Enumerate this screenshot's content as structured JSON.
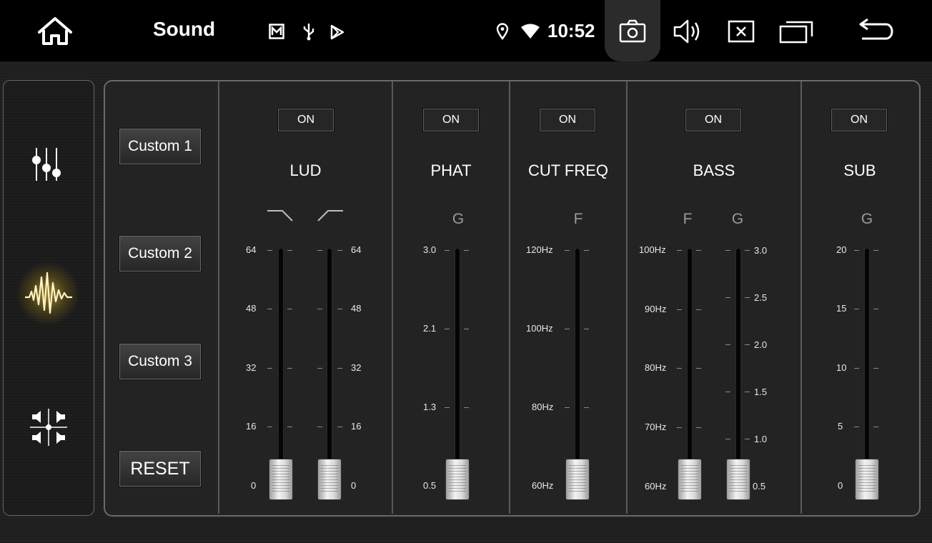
{
  "statusbar": {
    "title": "Sound",
    "clock": "10:52",
    "icons": [
      "home-icon",
      "gallery-notification-icon",
      "usb-icon",
      "play-store-icon",
      "location-icon",
      "wifi-icon",
      "screenshot-icon",
      "volume-icon",
      "close-app-icon",
      "recent-apps-icon",
      "back-icon"
    ]
  },
  "sidebar": {
    "items": [
      {
        "name": "equalizer-sliders-icon",
        "active": false
      },
      {
        "name": "sound-wave-icon",
        "active": true
      },
      {
        "name": "speaker-balance-icon",
        "active": false
      }
    ],
    "accent_color": "#ffd23c"
  },
  "presets": {
    "custom1": "Custom 1",
    "custom2": "Custom 2",
    "custom3": "Custom 3",
    "reset": "RESET"
  },
  "columns": {
    "lud": {
      "toggle": "ON",
      "title": "LUD",
      "sliders": [
        {
          "icon": "high-cut-filter-icon",
          "labels": [
            "64",
            "48",
            "32",
            "16",
            "0"
          ],
          "value": "0"
        },
        {
          "icon": "low-cut-filter-icon",
          "labels": [
            "64",
            "48",
            "32",
            "16",
            "0"
          ],
          "value": "0"
        }
      ]
    },
    "phat": {
      "toggle": "ON",
      "title": "PHAT",
      "sub": "G",
      "labels": [
        "3.0",
        "2.1",
        "1.3",
        "0.5"
      ],
      "value": "0.5"
    },
    "cut_freq": {
      "toggle": "ON",
      "title": "CUT FREQ",
      "sub": "F",
      "labels": [
        "120Hz",
        "100Hz",
        "80Hz",
        "60Hz"
      ],
      "value": "60Hz"
    },
    "bass": {
      "toggle": "ON",
      "title": "BASS",
      "sub_f": "F",
      "sub_g": "G",
      "f_labels": [
        "100Hz",
        "90Hz",
        "80Hz",
        "70Hz",
        "60Hz"
      ],
      "g_labels": [
        "3.0",
        "2.5",
        "2.0",
        "1.5",
        "1.0",
        "0.5"
      ],
      "f_value": "60Hz",
      "g_value": "0.5"
    },
    "sub": {
      "toggle": "ON",
      "title": "SUB",
      "sub": "G",
      "labels": [
        "20",
        "15",
        "10",
        "5",
        "0"
      ],
      "value": "0"
    }
  }
}
